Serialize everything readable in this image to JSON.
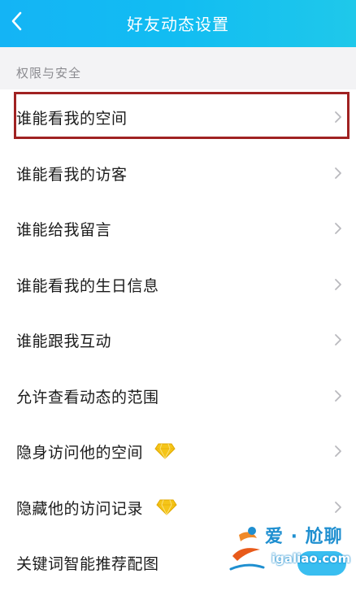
{
  "header": {
    "title": "好友动态设置",
    "background": "#14b4f5"
  },
  "section": {
    "title": "权限与安全"
  },
  "items": [
    {
      "label": "谁能看我的空间",
      "highlighted": true
    },
    {
      "label": "谁能看我的访客"
    },
    {
      "label": "谁能给我留言"
    },
    {
      "label": "谁能看我的生日信息"
    },
    {
      "label": "谁能跟我互动"
    },
    {
      "label": "允许查看动态的范围"
    },
    {
      "label": "隐身访问他的空间",
      "badge": "diamond-icon"
    },
    {
      "label": "隐藏他的访问记录",
      "badge": "diamond-icon"
    },
    {
      "label": "关键词智能推荐配图",
      "toggle": true
    }
  ],
  "watermark": {
    "text_cn": "爱 · 尬聊",
    "text_en": "igaliao.com"
  },
  "colors": {
    "highlight": "#a02222",
    "diamond": "#f5c518",
    "toggle_on": "#24b7ee"
  }
}
